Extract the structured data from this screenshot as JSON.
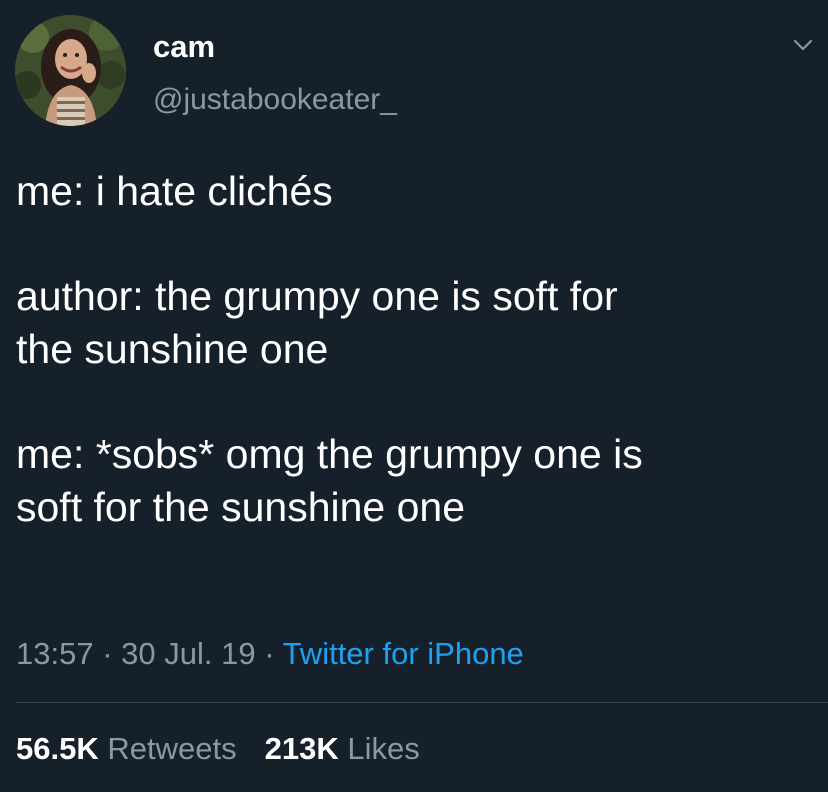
{
  "user": {
    "display_name": "cam",
    "handle": "@justabookeater_"
  },
  "tweet": {
    "lines": [
      "me: i hate clichés",
      "",
      "author: the grumpy one is soft for",
      "the sunshine one",
      "",
      "me: *sobs* omg the grumpy one is",
      "soft for the sunshine one"
    ]
  },
  "meta": {
    "time": "13:57",
    "separator": " · ",
    "date": "30 Jul. 19",
    "source": "Twitter for iPhone"
  },
  "stats": {
    "retweets_count": "56.5K",
    "retweets_label": "Retweets",
    "likes_count": "213K",
    "likes_label": "Likes"
  },
  "colors": {
    "background": "#15202b",
    "primary_text": "#ffffff",
    "secondary_text": "#8899a6",
    "link": "#1da1f2",
    "divider": "#38444d"
  },
  "icons": {
    "menu": "chevron-down-icon",
    "avatar": "avatar"
  }
}
